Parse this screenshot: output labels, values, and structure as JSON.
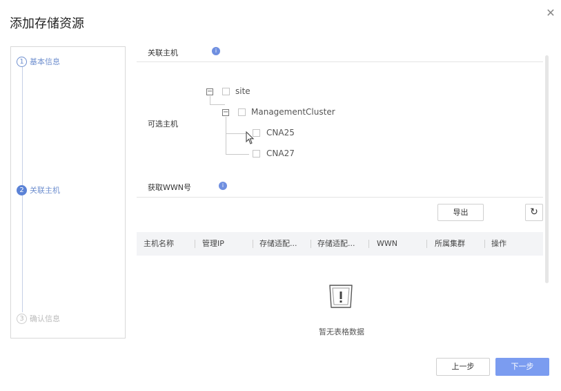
{
  "dialog": {
    "title": "添加存储资源",
    "close_glyph": "✕"
  },
  "steps": [
    {
      "num": "1",
      "label": "基本信息",
      "state": "done"
    },
    {
      "num": "2",
      "label": "关联主机",
      "state": "active"
    },
    {
      "num": "3",
      "label": "确认信息",
      "state": "pending"
    }
  ],
  "hosts_section": {
    "title": "关联主机",
    "info_glyph": "i",
    "selectable_label": "可选主机"
  },
  "tree": {
    "root": {
      "label": "site",
      "expanded": true
    },
    "cluster": {
      "label": "ManagementCluster",
      "expanded": true
    },
    "hosts": [
      {
        "label": "CNA25"
      },
      {
        "label": "CNA27"
      }
    ],
    "expand_glyph": "−"
  },
  "wwn_section": {
    "title": "获取WWN号",
    "info_glyph": "i"
  },
  "toolbar": {
    "export_label": "导出",
    "refresh_glyph": "↻"
  },
  "table": {
    "columns": [
      "主机名称",
      "管理IP",
      "存储适配...",
      "存储适配...",
      "WWN",
      "所属集群",
      "操作"
    ],
    "empty_text": "暂无表格数据"
  },
  "footer": {
    "prev_label": "上一步",
    "next_label": "下一步"
  },
  "colors": {
    "accent": "#7b9cf0",
    "step_active": "#5b82d6"
  }
}
